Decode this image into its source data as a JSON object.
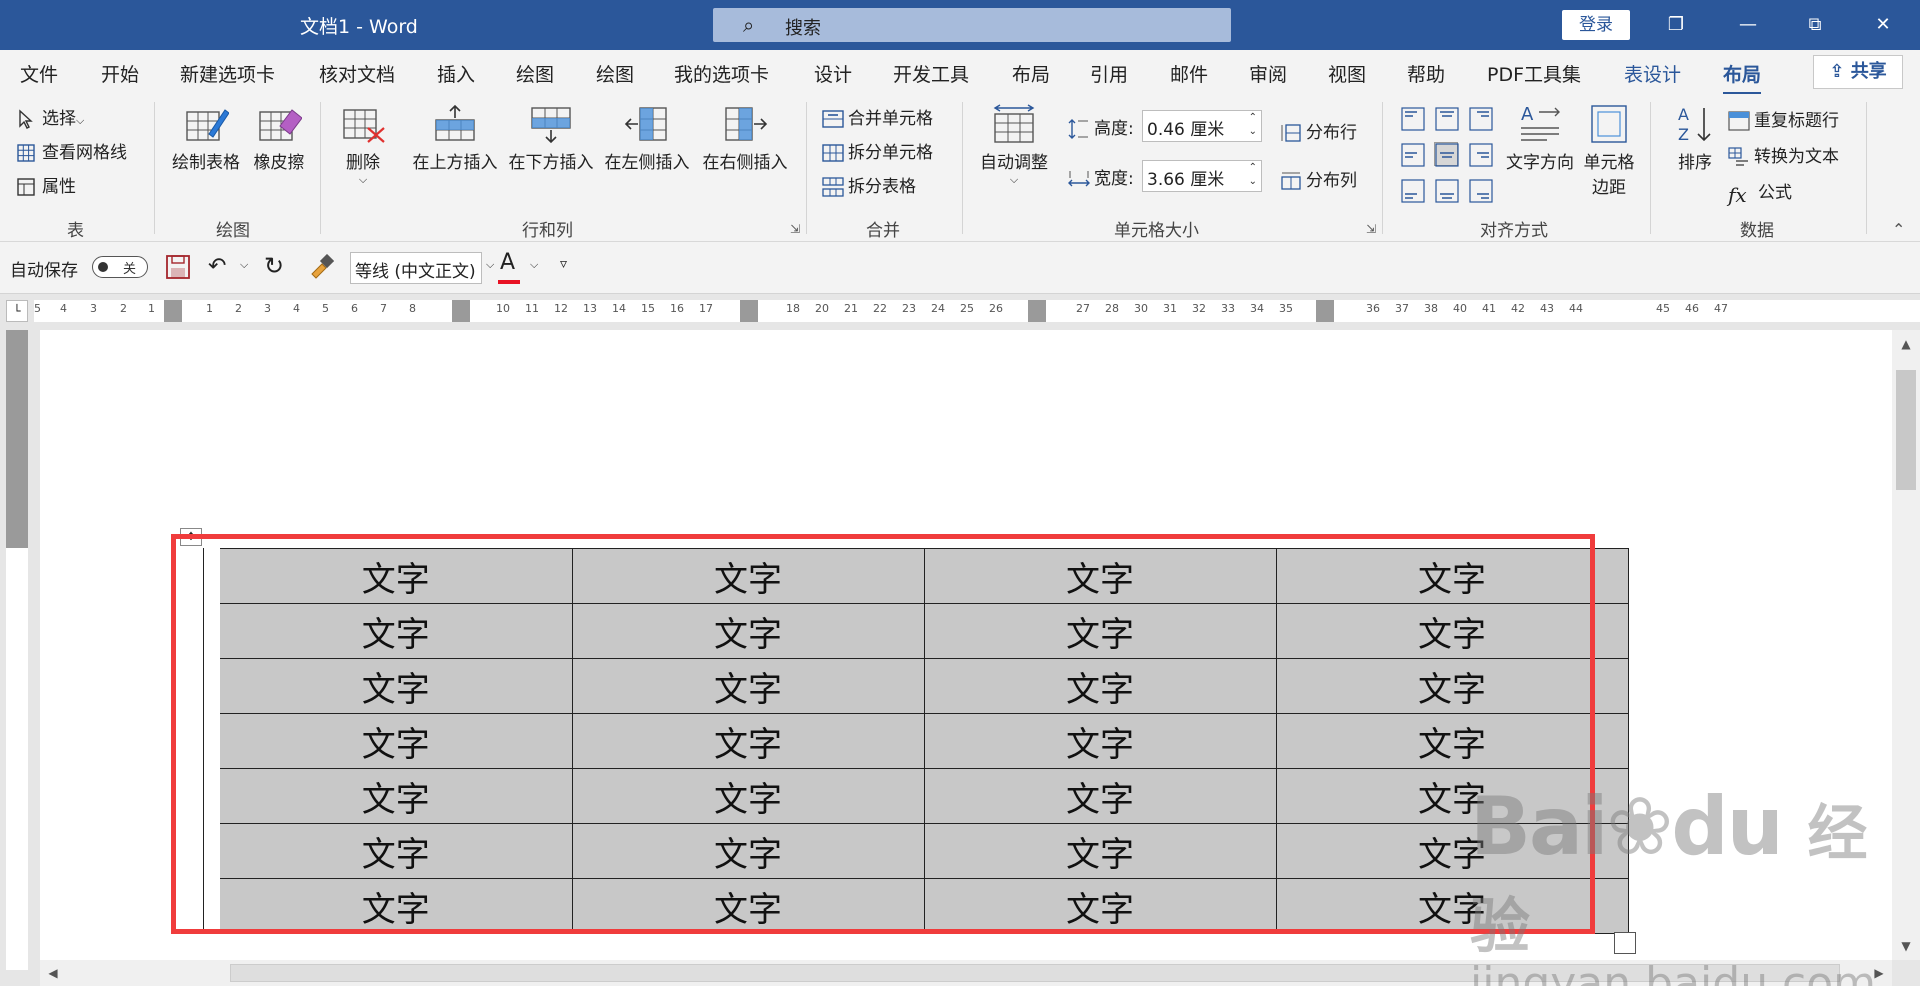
{
  "window": {
    "title": "文档1  -  Word",
    "search_placeholder": "搜索",
    "login_label": "登录"
  },
  "tabs": [
    "文件",
    "开始",
    "新建选项卡",
    "核对文档",
    "插入",
    "绘图",
    "绘图",
    "我的选项卡",
    "设计",
    "开发工具",
    "布局",
    "引用",
    "邮件",
    "审阅",
    "视图",
    "帮助",
    "PDF工具集",
    "表设计",
    "布局"
  ],
  "share_label": "共享",
  "ribbon": {
    "table_group": {
      "label": "表",
      "select": "选择",
      "view_gridlines": "查看网格线",
      "properties": "属性"
    },
    "draw_group": {
      "label": "绘图",
      "draw_table": "绘制表格",
      "eraser": "橡皮擦"
    },
    "rows_cols_group": {
      "label": "行和列",
      "delete": "删除",
      "insert_above": "在上方插入",
      "insert_below": "在下方插入",
      "insert_left": "在左侧插入",
      "insert_right": "在右侧插入"
    },
    "merge_group": {
      "label": "合并",
      "merge_cells": "合并单元格",
      "split_cells": "拆分单元格",
      "split_table": "拆分表格"
    },
    "cell_size_group": {
      "label": "单元格大小",
      "autofit": "自动调整",
      "height_label": "高度:",
      "height_value": "0.46 厘米",
      "width_label": "宽度:",
      "width_value": "3.66 厘米",
      "distribute_rows": "分布行",
      "distribute_cols": "分布列"
    },
    "alignment_group": {
      "label": "对齐方式",
      "text_direction": "文字方向",
      "cell_margins_1": "单元格",
      "cell_margins_2": "边距"
    },
    "data_group": {
      "label": "数据",
      "sort": "排序",
      "repeat_header": "重复标题行",
      "convert_to_text": "转换为文本",
      "formula": "公式"
    }
  },
  "qat": {
    "autosave_label": "自动保存",
    "toggle_state": "关",
    "font_name": "等线 (中文正文)"
  },
  "ruler_numbers": [
    "5",
    "4",
    "3",
    "2",
    "1",
    "1",
    "2",
    "3",
    "4",
    "5",
    "6",
    "7",
    "8",
    "10",
    "11",
    "12",
    "13",
    "14",
    "15",
    "16",
    "17",
    "18",
    "20",
    "21",
    "22",
    "23",
    "24",
    "25",
    "26",
    "27",
    "28",
    "30",
    "31",
    "32",
    "33",
    "34",
    "35",
    "36",
    "37",
    "38",
    "40",
    "41",
    "42",
    "43",
    "44",
    "45",
    "46",
    "47"
  ],
  "table": {
    "rows": [
      [
        "文字",
        "文字",
        "文字",
        "文字"
      ],
      [
        "文字",
        "文字",
        "文字",
        "文字"
      ],
      [
        "文字",
        "文字",
        "文字",
        "文字"
      ],
      [
        "文字",
        "文字",
        "文字",
        "文字"
      ],
      [
        "文字",
        "文字",
        "文字",
        "文字"
      ],
      [
        "文字",
        "文字",
        "文字",
        "文字"
      ],
      [
        "文字",
        "文字",
        "文字",
        "文字"
      ]
    ]
  },
  "watermark": {
    "line1": "Bai",
    "line1b": "du",
    "line1c": "经验",
    "line2": "jingyan.baidu.com"
  },
  "colors": {
    "titlebar": "#2b579a",
    "highlight": "#f03c3c",
    "cell_fill": "#c8c8c8"
  }
}
